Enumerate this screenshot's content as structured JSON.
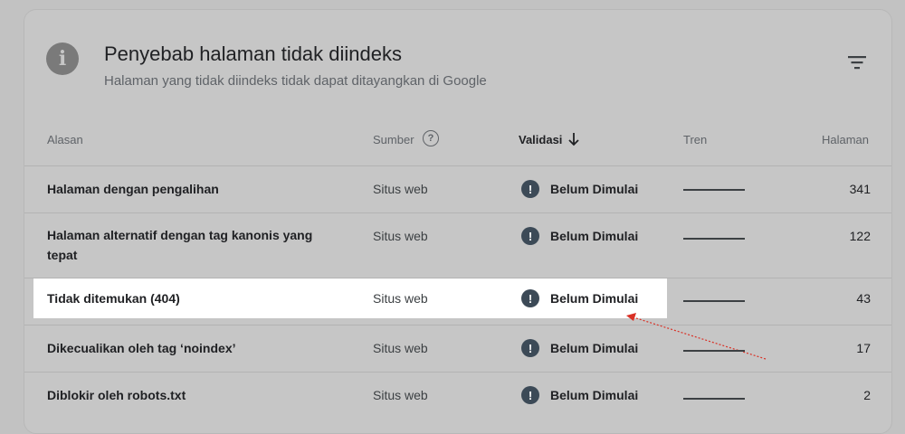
{
  "card": {
    "title": "Penyebab halaman tidak diindeks",
    "subtitle": "Halaman yang tidak diindeks tidak dapat ditayangkan di Google",
    "info_icon": "info-icon",
    "filter_icon": "filter-icon"
  },
  "columns": {
    "reason": "Alasan",
    "source": "Sumber",
    "validation": "Validasi",
    "trend": "Tren",
    "pages": "Halaman"
  },
  "rows": [
    {
      "reason": "Halaman dengan pengalihan",
      "source": "Situs web",
      "status": "Belum Dimulai",
      "pages": "341"
    },
    {
      "reason": "Halaman alternatif dengan tag kanonis yang tepat",
      "source": "Situs web",
      "status": "Belum Dimulai",
      "pages": "122"
    },
    {
      "reason": "Tidak ditemukan (404)",
      "source": "Situs web",
      "status": "Belum Dimulai",
      "pages": "43"
    },
    {
      "reason": "Dikecualikan oleh tag ‘noindex’",
      "source": "Situs web",
      "status": "Belum Dimulai",
      "pages": "17"
    },
    {
      "reason": "Diblokir oleh robots.txt",
      "source": "Situs web",
      "status": "Belum Dimulai",
      "pages": "2"
    }
  ],
  "colors": {
    "highlight": "#ffffff",
    "annotation_arrow": "#d93025",
    "status_icon": "#3c4a57"
  }
}
